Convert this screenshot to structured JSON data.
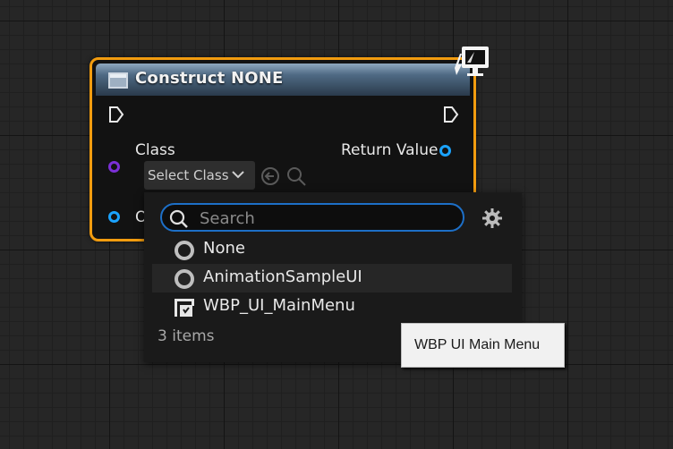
{
  "node": {
    "title": "Construct NONE",
    "class_label": "Class",
    "return_label": "Return Value",
    "owner_label_partial": "O",
    "class_select": "Select Class"
  },
  "dropdown": {
    "search_placeholder": "Search",
    "items": [
      {
        "label": "None",
        "icon": "circle-icon"
      },
      {
        "label": "AnimationSampleUI",
        "icon": "circle-icon"
      },
      {
        "label": "WBP_UI_MainMenu",
        "icon": "widget-blueprint-icon"
      }
    ],
    "count": "3 items"
  },
  "tooltip": "WBP UI Main Menu",
  "colors": {
    "node_border": "#f29c0f",
    "class_pin": "#7b2fd6",
    "object_pin": "#1ba3ff",
    "search_border": "#1d6fc7"
  }
}
